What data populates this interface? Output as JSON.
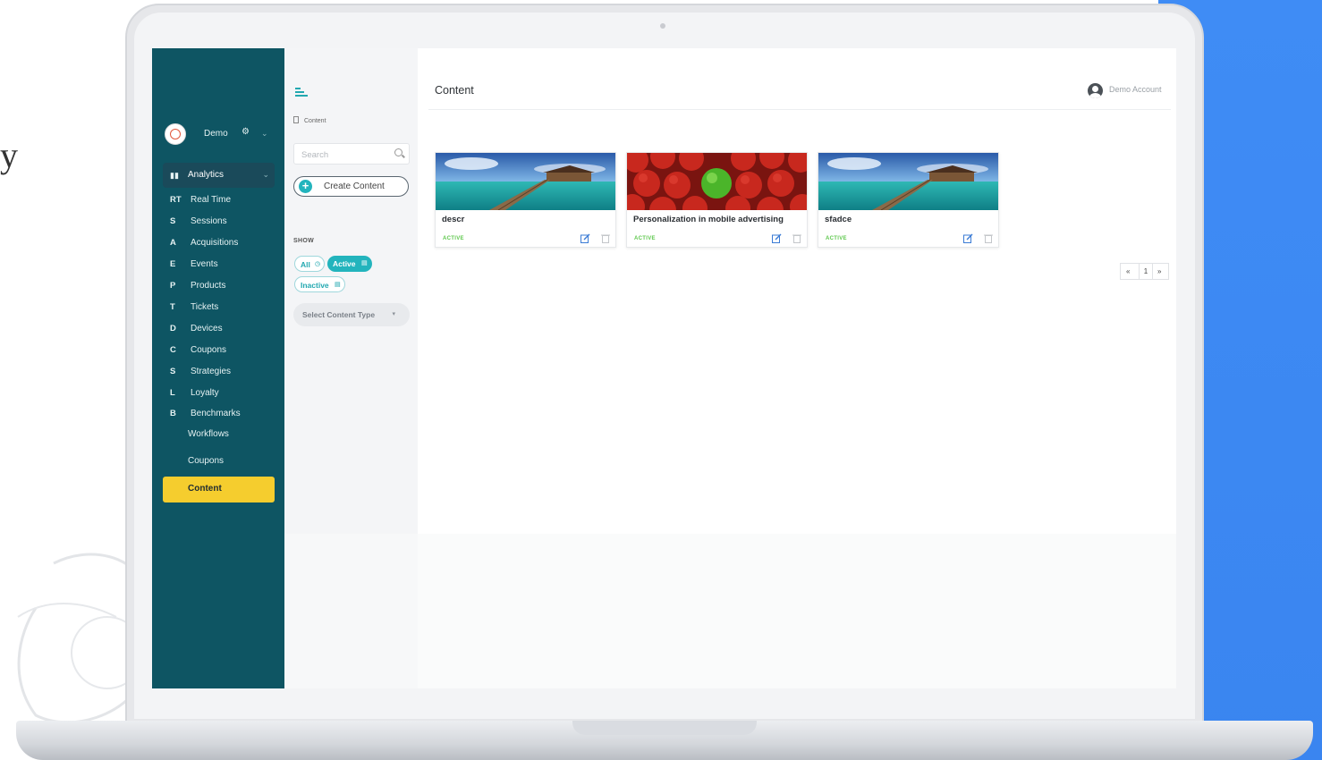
{
  "colors": {
    "sidebar": "#0e5563",
    "active_nav": "#f5cd2e",
    "accent": "#23b4bd",
    "status_active": "#5fc84e",
    "edit_icon": "#3a7bd5"
  },
  "sidebar": {
    "brand_name": "Demo",
    "brand_icons": [
      "gear-icon",
      "chevron-down-icon"
    ],
    "analytics": {
      "label": "Analytics",
      "icon": "bar-chart-icon"
    },
    "items": [
      {
        "abbr": "RT",
        "label": "Real Time"
      },
      {
        "abbr": "S",
        "label": "Sessions"
      },
      {
        "abbr": "A",
        "label": "Acquisitions"
      },
      {
        "abbr": "E",
        "label": "Events"
      },
      {
        "abbr": "P",
        "label": "Products"
      },
      {
        "abbr": "T",
        "label": "Tickets"
      },
      {
        "abbr": "D",
        "label": "Devices"
      },
      {
        "abbr": "C",
        "label": "Coupons"
      },
      {
        "abbr": "S",
        "label": "Strategies"
      },
      {
        "abbr": "L",
        "label": "Loyalty"
      },
      {
        "abbr": "B",
        "label": "Benchmarks"
      }
    ],
    "workflows": "Workflows",
    "coupons": "Coupons",
    "content": "Content"
  },
  "panel": {
    "breadcrumb": "Content",
    "search_placeholder": "Search",
    "create_label": "Create Content",
    "show_label": "SHOW",
    "filters": {
      "all": "All",
      "active": "Active",
      "inactive": "Inactive"
    },
    "select_content_type": "Select Content Type",
    "select_arrow": "▾"
  },
  "header": {
    "title": "Content",
    "account_name": "Demo Account"
  },
  "cards": [
    {
      "title": "descr",
      "status": "ACTIVE",
      "image": "beach-pier-image"
    },
    {
      "title": "Personalization in mobile advertising",
      "status": "ACTIVE",
      "image": "apples-image"
    },
    {
      "title": "sfadce",
      "status": "ACTIVE",
      "image": "beach-pier-image"
    }
  ],
  "pagination": {
    "prev": "«",
    "current": "1",
    "next": "»"
  },
  "background": {
    "left_glyph": "y"
  }
}
